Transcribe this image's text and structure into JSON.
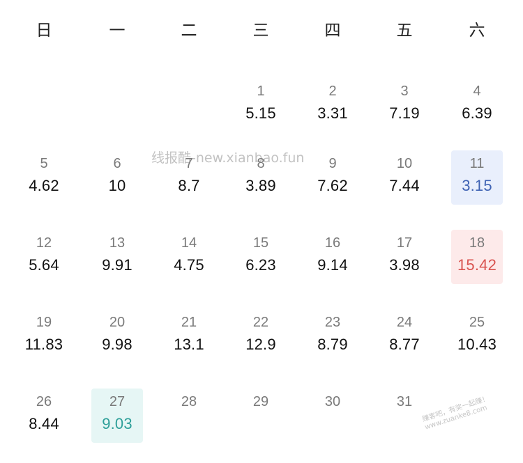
{
  "weekdays": [
    "日",
    "一",
    "二",
    "三",
    "四",
    "五",
    "六"
  ],
  "days": [
    {
      "day": "1",
      "value": "5.15",
      "col": 3,
      "row": 0,
      "highlight": ""
    },
    {
      "day": "2",
      "value": "3.31",
      "col": 4,
      "row": 0,
      "highlight": ""
    },
    {
      "day": "3",
      "value": "7.19",
      "col": 5,
      "row": 0,
      "highlight": ""
    },
    {
      "day": "4",
      "value": "6.39",
      "col": 6,
      "row": 0,
      "highlight": ""
    },
    {
      "day": "5",
      "value": "4.62",
      "col": 0,
      "row": 1,
      "highlight": ""
    },
    {
      "day": "6",
      "value": "10",
      "col": 1,
      "row": 1,
      "highlight": ""
    },
    {
      "day": "7",
      "value": "8.7",
      "col": 2,
      "row": 1,
      "highlight": ""
    },
    {
      "day": "8",
      "value": "3.89",
      "col": 3,
      "row": 1,
      "highlight": ""
    },
    {
      "day": "9",
      "value": "7.62",
      "col": 4,
      "row": 1,
      "highlight": ""
    },
    {
      "day": "10",
      "value": "7.44",
      "col": 5,
      "row": 1,
      "highlight": ""
    },
    {
      "day": "11",
      "value": "3.15",
      "col": 6,
      "row": 1,
      "highlight": "blue"
    },
    {
      "day": "12",
      "value": "5.64",
      "col": 0,
      "row": 2,
      "highlight": ""
    },
    {
      "day": "13",
      "value": "9.91",
      "col": 1,
      "row": 2,
      "highlight": ""
    },
    {
      "day": "14",
      "value": "4.75",
      "col": 2,
      "row": 2,
      "highlight": ""
    },
    {
      "day": "15",
      "value": "6.23",
      "col": 3,
      "row": 2,
      "highlight": ""
    },
    {
      "day": "16",
      "value": "9.14",
      "col": 4,
      "row": 2,
      "highlight": ""
    },
    {
      "day": "17",
      "value": "3.98",
      "col": 5,
      "row": 2,
      "highlight": ""
    },
    {
      "day": "18",
      "value": "15.42",
      "col": 6,
      "row": 2,
      "highlight": "red"
    },
    {
      "day": "19",
      "value": "11.83",
      "col": 0,
      "row": 3,
      "highlight": ""
    },
    {
      "day": "20",
      "value": "9.98",
      "col": 1,
      "row": 3,
      "highlight": ""
    },
    {
      "day": "21",
      "value": "13.1",
      "col": 2,
      "row": 3,
      "highlight": ""
    },
    {
      "day": "22",
      "value": "12.9",
      "col": 3,
      "row": 3,
      "highlight": ""
    },
    {
      "day": "23",
      "value": "8.79",
      "col": 4,
      "row": 3,
      "highlight": ""
    },
    {
      "day": "24",
      "value": "8.77",
      "col": 5,
      "row": 3,
      "highlight": ""
    },
    {
      "day": "25",
      "value": "10.43",
      "col": 6,
      "row": 3,
      "highlight": ""
    },
    {
      "day": "26",
      "value": "8.44",
      "col": 0,
      "row": 4,
      "highlight": ""
    },
    {
      "day": "27",
      "value": "9.03",
      "col": 1,
      "row": 4,
      "highlight": "teal"
    },
    {
      "day": "28",
      "value": "",
      "col": 2,
      "row": 4,
      "highlight": ""
    },
    {
      "day": "29",
      "value": "",
      "col": 3,
      "row": 4,
      "highlight": ""
    },
    {
      "day": "30",
      "value": "",
      "col": 4,
      "row": 4,
      "highlight": ""
    },
    {
      "day": "31",
      "value": "",
      "col": 5,
      "row": 4,
      "highlight": ""
    }
  ],
  "highlight_colors": {
    "blue": {
      "bg": "#e9effc",
      "text": "#3f63b4"
    },
    "red": {
      "bg": "#fdeaea",
      "text": "#d9534f"
    },
    "teal": {
      "bg": "#e6f6f5",
      "text": "#2d9f99"
    }
  },
  "watermark": {
    "text": "线报酷-new.xianbao.fun"
  },
  "corner_watermark": {
    "line1": "赚客吧，有奖一起赚！",
    "line2": "www.zuanke8.com"
  }
}
